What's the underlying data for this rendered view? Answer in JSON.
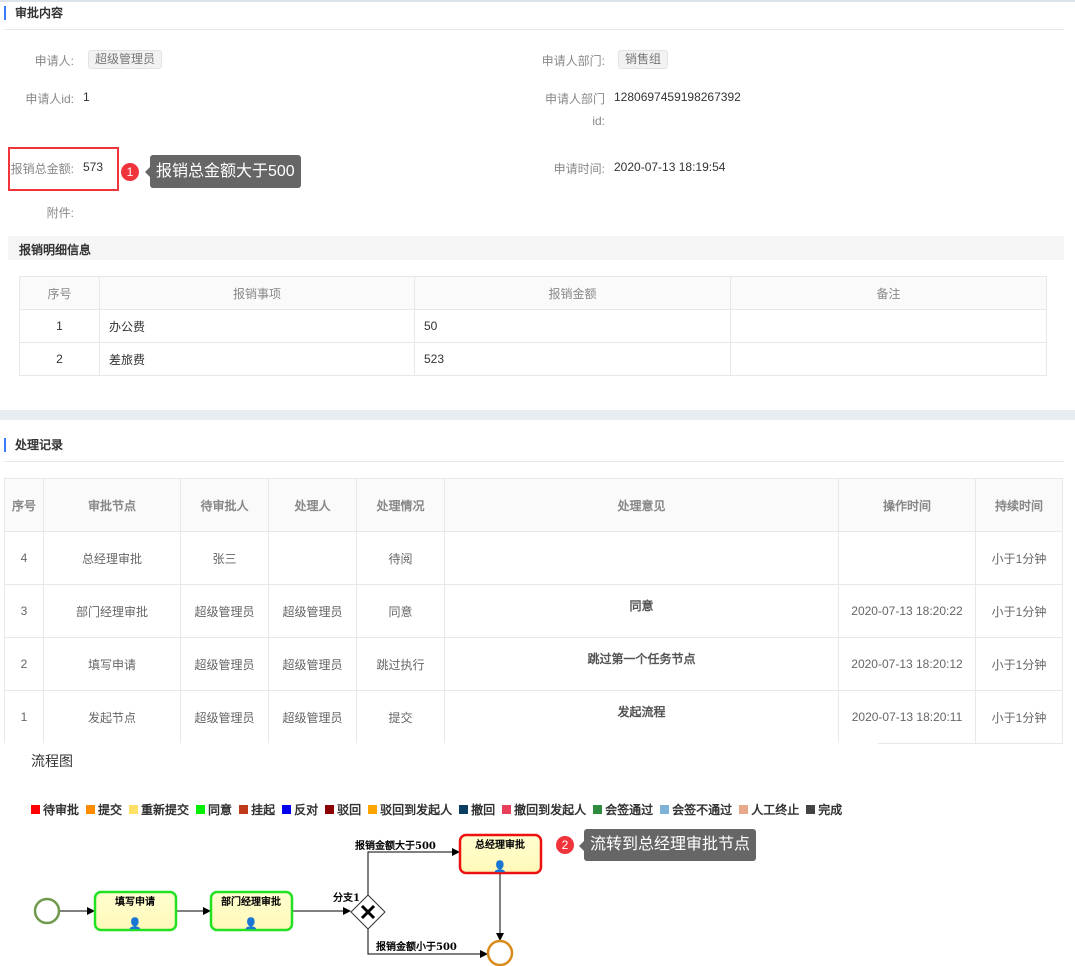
{
  "approval": {
    "title": "审批内容",
    "applicant_label": "申请人:",
    "applicant": "超级管理员",
    "dept_label": "申请人部门:",
    "dept": "销售组",
    "applicant_id_label": "申请人id:",
    "applicant_id": "1",
    "dept_id_label_1": "申请人部门",
    "dept_id_label_2": "id:",
    "dept_id": "1280697459198267392",
    "total_label": "报销总金额:",
    "total": "573",
    "time_label": "申请时间:",
    "time": "2020-07-13 18:19:54",
    "attach_label": "附件:",
    "annotation1_num": "1",
    "annotation1": "报销总金额大于500"
  },
  "detail": {
    "title": "报销明细信息",
    "headers": [
      "序号",
      "报销事项",
      "报销金额",
      "备注"
    ],
    "rows": [
      [
        "1",
        "办公费",
        "50",
        ""
      ],
      [
        "2",
        "差旅费",
        "523",
        ""
      ]
    ]
  },
  "records": {
    "title": "处理记录",
    "headers": [
      "序号",
      "审批节点",
      "待审批人",
      "处理人",
      "处理情况",
      "处理意见",
      "操作时间",
      "持续时间"
    ],
    "rows": [
      [
        "4",
        "总经理审批",
        "张三",
        "",
        "待阅",
        "",
        "",
        "小于1分钟"
      ],
      [
        "3",
        "部门经理审批",
        "超级管理员",
        "超级管理员",
        "同意",
        "同意",
        "2020-07-13 18:20:22",
        "小于1分钟"
      ],
      [
        "2",
        "填写申请",
        "超级管理员",
        "超级管理员",
        "跳过执行",
        "跳过第一个任务节点",
        "2020-07-13 18:20:12",
        "小于1分钟"
      ],
      [
        "1",
        "发起节点",
        "超级管理员",
        "超级管理员",
        "提交",
        "发起流程",
        "2020-07-13 18:20:11",
        "小于1分钟"
      ]
    ]
  },
  "flow": {
    "title": "流程图",
    "legend": [
      {
        "label": "待审批",
        "color": "#ff0000"
      },
      {
        "label": "提交",
        "color": "#ff8c00"
      },
      {
        "label": "重新提交",
        "color": "#ffe066"
      },
      {
        "label": "同意",
        "color": "#00ee00"
      },
      {
        "label": "挂起",
        "color": "#c0391b"
      },
      {
        "label": "反对",
        "color": "#0000ee"
      },
      {
        "label": "驳回",
        "color": "#8b0000"
      },
      {
        "label": "驳回到发起人",
        "color": "#ffa500"
      },
      {
        "label": "撤回",
        "color": "#0a3d62"
      },
      {
        "label": "撤回到发起人",
        "color": "#e8405a"
      },
      {
        "label": "会签通过",
        "color": "#2e8b40"
      },
      {
        "label": "会签不通过",
        "color": "#7fb2d8"
      },
      {
        "label": "人工终止",
        "color": "#e8a88c"
      },
      {
        "label": "完成",
        "color": "#444444"
      }
    ],
    "task1": "填写申请",
    "task2": "部门经理审批",
    "task3": "总经理审批",
    "gateway": "分支1",
    "edge_gt": "报销金额大于500",
    "edge_lt": "报销金额小于500",
    "annotation2_num": "2",
    "annotation2": "流转到总经理审批节点"
  }
}
